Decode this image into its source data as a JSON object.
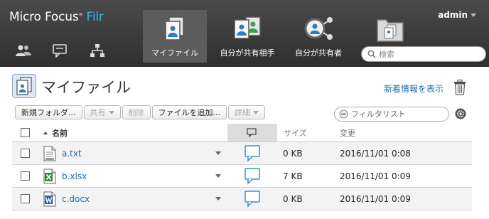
{
  "header": {
    "brand_name": "Micro Focus",
    "brand_reg": "®",
    "brand_product": "Filr",
    "user": "admin",
    "search_placeholder": "検索",
    "left_icons": [
      "people-icon",
      "comments-icon",
      "org-chart-icon"
    ],
    "tabs": [
      {
        "label": "マイファイル",
        "icon": "my-files-icon",
        "active": true
      },
      {
        "label": "自分が共有相手",
        "icon": "shared-with-me-icon",
        "active": false
      },
      {
        "label": "自分が共有者",
        "icon": "shared-by-me-icon",
        "active": false
      },
      {
        "label": "",
        "icon": "net-folders-icon",
        "active": false
      }
    ]
  },
  "page": {
    "title": "マイファイル",
    "whats_new": "新着情報を表示"
  },
  "toolbar": {
    "new_folder": "新規フォルダ...",
    "share": "共有",
    "delete": "削除",
    "add_file": "ファイルを追加...",
    "details": "詳細",
    "filter_placeholder": "フィルタリスト"
  },
  "table": {
    "columns": {
      "name": "名前",
      "size": "サイズ",
      "modified": "変更"
    },
    "rows": [
      {
        "name": "a.txt",
        "size": "0 KB",
        "modified": "2016/11/01 0:08",
        "type": "txt"
      },
      {
        "name": "b.xlsx",
        "size": "7 KB",
        "modified": "2016/11/01 0:09",
        "type": "xlsx"
      },
      {
        "name": "c.docx",
        "size": "0 KB",
        "modified": "2016/11/01 0:09",
        "type": "docx"
      }
    ]
  },
  "colors": {
    "accent": "#33b6e0",
    "link": "#1a6fa8",
    "header_bg": "#3a3a3a"
  }
}
